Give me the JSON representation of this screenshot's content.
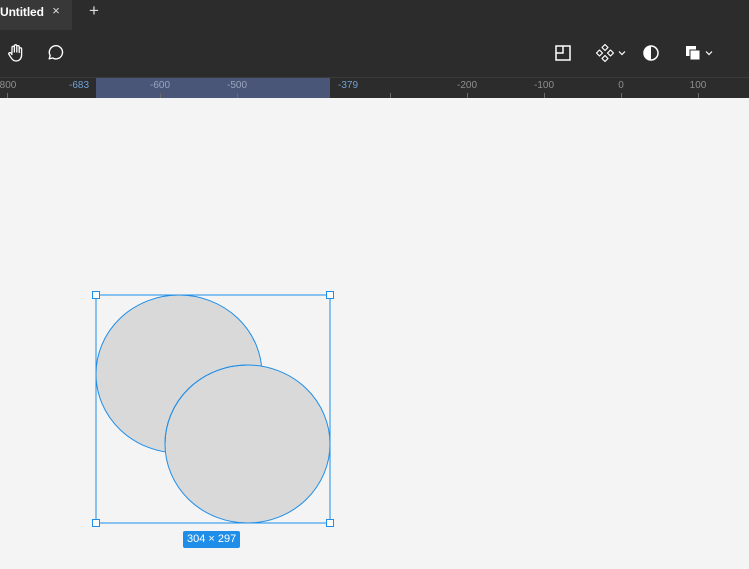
{
  "tabs": [
    {
      "title": "Untitled",
      "close_icon": "×"
    }
  ],
  "new_tab_icon": "+",
  "toolbar": {
    "left_tools": [
      "hand-tool-icon",
      "comment-tool-icon"
    ],
    "right_tools": [
      "frame-icon",
      "component-icon",
      "mask-icon",
      "boolean-icon"
    ]
  },
  "ruler": {
    "labels": [
      "800",
      "-683",
      "-600",
      "-500",
      "-379",
      "-200",
      "-100",
      "0",
      "100"
    ],
    "selection_start": "-683",
    "selection_end": "-379"
  },
  "selection": {
    "size_label": "304 × 297",
    "shapes": [
      "ellipse",
      "ellipse"
    ]
  },
  "colors": {
    "chrome": "#2c2c2c",
    "canvas": "#f4f4f4",
    "selection": "#1e8ee8",
    "shape_fill": "#d9d9d9"
  }
}
